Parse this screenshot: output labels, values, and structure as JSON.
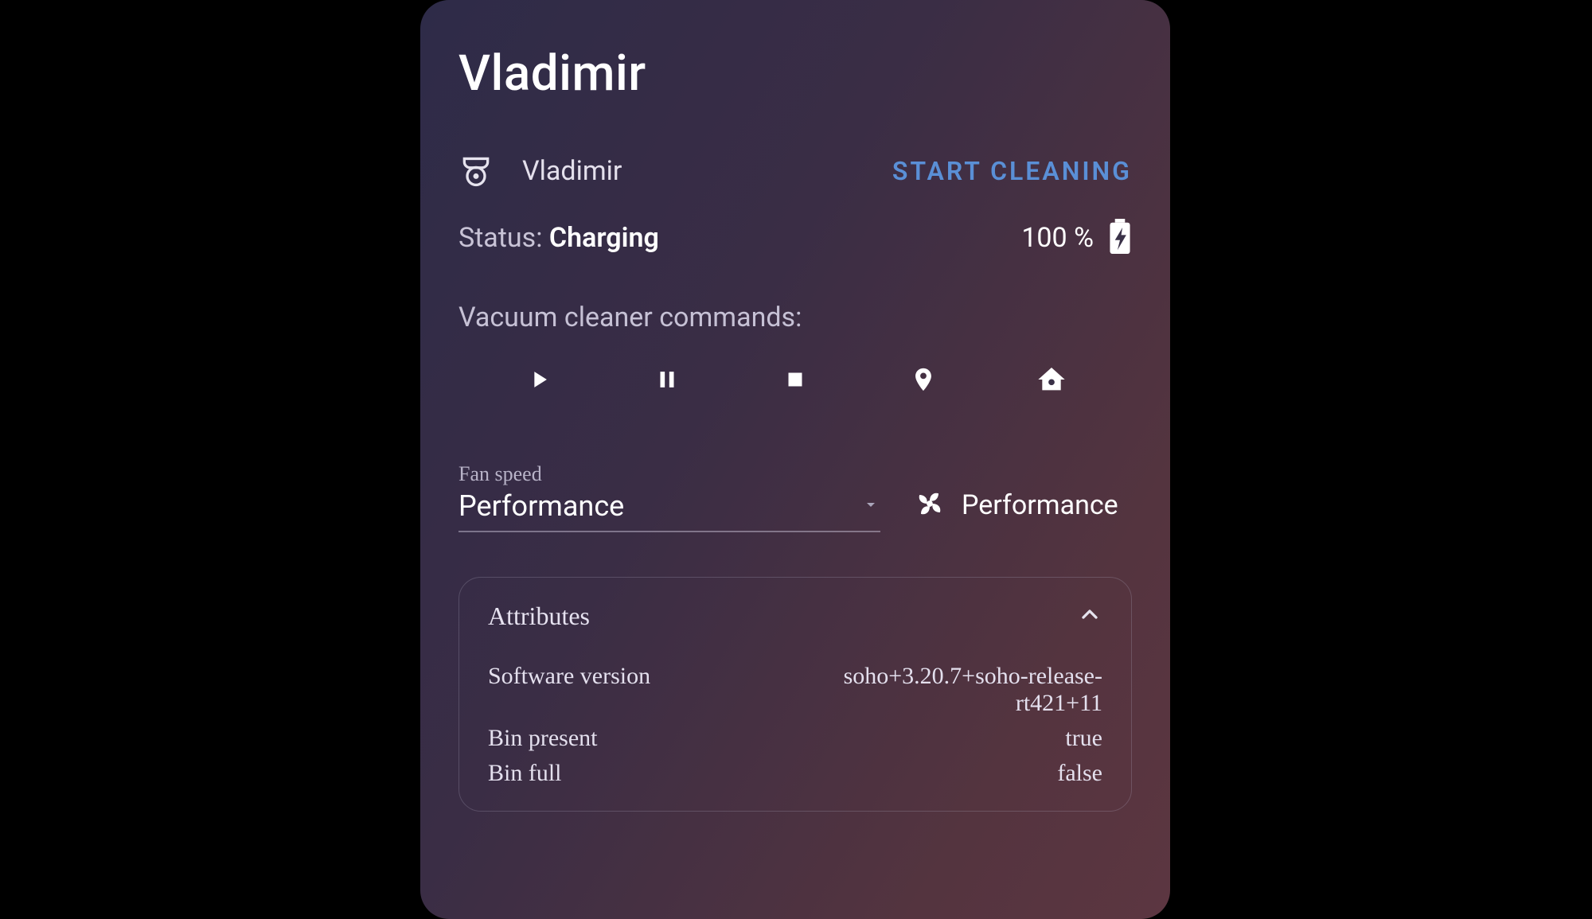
{
  "title": "Vladimir",
  "device": {
    "name": "Vladimir",
    "action_button": "START CLEANING",
    "status_label": "Status: ",
    "status_value": "Charging",
    "battery_pct": "100 %"
  },
  "commands": {
    "label": "Vacuum cleaner commands:",
    "items": [
      "play",
      "pause",
      "stop",
      "locate",
      "home"
    ]
  },
  "fan": {
    "label": "Fan speed",
    "selected": "Performance",
    "status": "Performance"
  },
  "attributes": {
    "header": "Attributes",
    "rows": [
      {
        "key": "Software version",
        "value": "soho+3.20.7+soho-release-rt421+11"
      },
      {
        "key": "Bin present",
        "value": "true"
      },
      {
        "key": "Bin full",
        "value": "false"
      }
    ]
  }
}
